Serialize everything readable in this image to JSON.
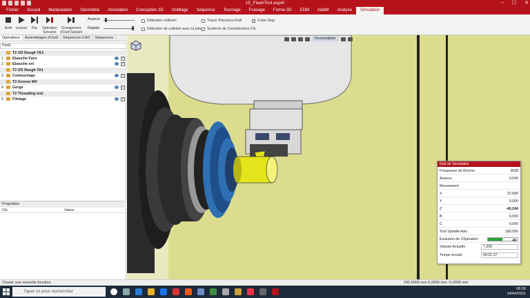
{
  "window": {
    "title": "15_FlashTool.esprit"
  },
  "menu": [
    "Fichier",
    "Accueil",
    "Manipulation",
    "Géométrie",
    "Annotation",
    "Conception 3D",
    "Outillage",
    "Séquence",
    "Tournage",
    "Fraisage",
    "Forme 3D",
    "EDM",
    "Additif",
    "Analyse",
    "Simulation"
  ],
  "ribbon": {
    "buttons": [
      {
        "label": "Arrêt",
        "icon": "stop-icon"
      },
      {
        "label": "Lecture",
        "icon": "play-icon"
      },
      {
        "label": "Pas",
        "icon": "step-icon"
      },
      {
        "label": "Opération Suivante",
        "icon": "next-operation-icon"
      },
      {
        "label": "Changement d'Outil Suivant",
        "icon": "next-tool-change-icon"
      }
    ],
    "speed_label": "Avance",
    "speed_level": 0.05,
    "fast_label": "Rapide",
    "fast_level": 0.9,
    "checks": [
      {
        "label": "Détection collision",
        "checked": false
      },
      {
        "label": "Détection de collision avec la pièce",
        "checked": false
      },
      {
        "label": "Tracer Parcours-Outil",
        "checked": false
      },
      {
        "label": "Système de Coordonnées CN",
        "checked": false
      },
      {
        "label": "Code Stop",
        "checked": true
      }
    ]
  },
  "left": {
    "tabs": [
      "Opérations",
      "Assemblages d'Outil",
      "Séquences CAO",
      "Séquences"
    ],
    "part": "Part1",
    "groups": [
      {
        "title": "T2 OD Rough TA3",
        "ops": [
          {
            "n": "1",
            "label": "Ebauche Face"
          },
          {
            "n": "2",
            "label": "Ebauche ext"
          }
        ]
      },
      {
        "title": "T2 OD Rough TA1",
        "ops": [
          {
            "n": "3",
            "label": "Contournage"
          }
        ]
      },
      {
        "title": "T2 Groove W4",
        "ops": [
          {
            "n": "4",
            "label": "Gorge"
          }
        ]
      },
      {
        "title": "T2 Threading tool",
        "ops": [
          {
            "n": "5",
            "label": "Filetage"
          }
        ]
      }
    ],
    "props_title": "Propriétés",
    "props_cols": [
      "Clé",
      "Valeur"
    ]
  },
  "viewport": {
    "view_mode": "Personnaliser"
  },
  "sim": {
    "title": "Etat de Simulation",
    "rows": [
      {
        "k": "Fréquence de Broche",
        "v": "3638"
      },
      {
        "k": "Avance",
        "v": "0,040"
      },
      {
        "k": "Mouvement",
        "v": ""
      },
      {
        "k": "X",
        "v": "22,000"
      },
      {
        "k": "Y",
        "v": "0,000"
      },
      {
        "k": "Z",
        "v": "-46,244"
      },
      {
        "k": "B",
        "v": "0,000"
      },
      {
        "k": "C",
        "v": "0,000"
      },
      {
        "k": "Tool Spindle Axis",
        "v": "180,000"
      },
      {
        "k": "Evolution de l'Opération",
        "v": "49"
      }
    ],
    "progress": 0.49,
    "speed_label": "Vitesse Actuelle",
    "speed_value": "7,300",
    "elapsed_label": "Temps écoulé",
    "elapsed_value": "00:01:37"
  },
  "status": {
    "left": "Choisir une nouvelle fonction",
    "coords": "245,0000 mm  0,0000 mm  -5,0000 mm"
  },
  "taskbar": {
    "search_placeholder": "Taper ici pour rechercher",
    "time": "08:30",
    "date": "14/04/2021"
  },
  "colors": {
    "brand": "#b5121b",
    "background_part": "#dcdc8f",
    "tool_yellow": "#e4e41a",
    "chuck_blue": "#2f6fb3"
  }
}
